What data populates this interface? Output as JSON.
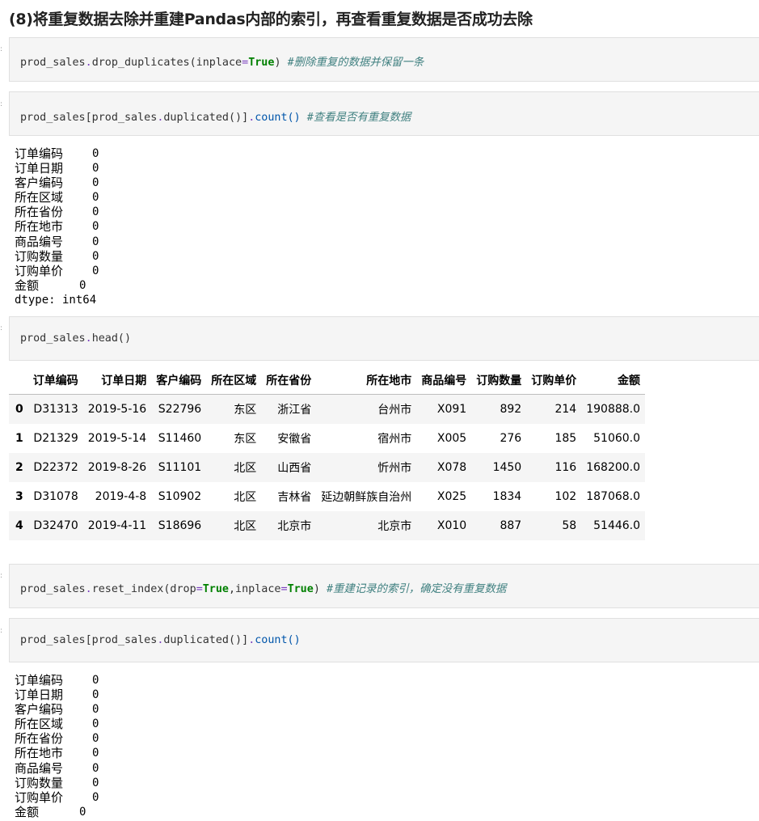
{
  "heading": "(8)将重复数据去除并重建Pandas内部的索引，再查看重复数据是否成功去除",
  "cells": {
    "c1": {
      "pre": "prod_sales",
      "dot": ".",
      "fn": "drop_duplicates(inplace",
      "eq": "=",
      "kw": "True",
      "close": ") ",
      "comment": "#删除重复的数据并保留一条"
    },
    "c2": {
      "a": "prod_sales[prod_sales",
      "dot": ".",
      "b": "duplicated()]",
      "dot2": ".",
      "c": "count() ",
      "comment": "#查看是否有重复数据"
    },
    "c3": {
      "a": "prod_sales",
      "dot": ".",
      "b": "head()"
    },
    "c4": {
      "a": "prod_sales",
      "dot": ".",
      "b": "reset_index(drop",
      "eq": "=",
      "kw1": "True",
      "comma": ",inplace",
      "eq2": "=",
      "kw2": "True",
      "close": ") ",
      "comment": "#重建记录的索引，确定没有重复数据"
    },
    "c5": {
      "a": "prod_sales[prod_sales",
      "dot": ".",
      "b": "duplicated()]",
      "dot2": ".",
      "c": "count()"
    }
  },
  "output1": {
    "rows": [
      {
        "k": "订单编码",
        "v": "0"
      },
      {
        "k": "订单日期",
        "v": "0"
      },
      {
        "k": "客户编码",
        "v": "0"
      },
      {
        "k": "所在区域",
        "v": "0"
      },
      {
        "k": "所在省份",
        "v": "0"
      },
      {
        "k": "所在地市",
        "v": "0"
      },
      {
        "k": "商品编号",
        "v": "0"
      },
      {
        "k": "订购数量",
        "v": "0"
      },
      {
        "k": "订购单价",
        "v": "0"
      },
      {
        "k": "金额",
        "v": "0"
      }
    ],
    "dtype": "dtype: int64"
  },
  "table": {
    "columns": [
      "",
      "订单编码",
      "订单日期",
      "客户编码",
      "所在区域",
      "所在省份",
      "所在地市",
      "商品编号",
      "订购数量",
      "订购单价",
      "金额"
    ],
    "rows": [
      [
        "0",
        "D31313",
        "2019-5-16",
        "S22796",
        "东区",
        "浙江省",
        "台州市",
        "X091",
        "892",
        "214",
        "190888.0"
      ],
      [
        "1",
        "D21329",
        "2019-5-14",
        "S11460",
        "东区",
        "安徽省",
        "宿州市",
        "X005",
        "276",
        "185",
        "51060.0"
      ],
      [
        "2",
        "D22372",
        "2019-8-26",
        "S11101",
        "北区",
        "山西省",
        "忻州市",
        "X078",
        "1450",
        "116",
        "168200.0"
      ],
      [
        "3",
        "D31078",
        "2019-4-8",
        "S10902",
        "北区",
        "吉林省",
        "延边朝鲜族自治州",
        "X025",
        "1834",
        "102",
        "187068.0"
      ],
      [
        "4",
        "D32470",
        "2019-4-11",
        "S18696",
        "北区",
        "北京市",
        "北京市",
        "X010",
        "887",
        "58",
        "51446.0"
      ]
    ]
  },
  "output2": {
    "rows": [
      {
        "k": "订单编码",
        "v": "0"
      },
      {
        "k": "订单日期",
        "v": "0"
      },
      {
        "k": "客户编码",
        "v": "0"
      },
      {
        "k": "所在区域",
        "v": "0"
      },
      {
        "k": "所在省份",
        "v": "0"
      },
      {
        "k": "所在地市",
        "v": "0"
      },
      {
        "k": "商品编号",
        "v": "0"
      },
      {
        "k": "订购数量",
        "v": "0"
      },
      {
        "k": "订购单价",
        "v": "0"
      },
      {
        "k": "金额",
        "v": "0"
      }
    ]
  }
}
